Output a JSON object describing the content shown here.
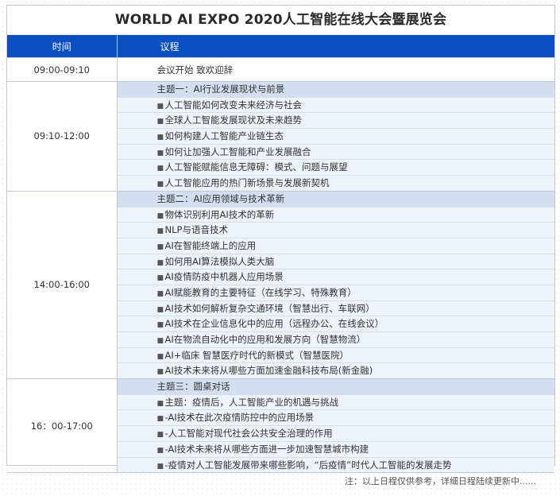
{
  "title": "WORLD AI EXPO 2020人工智能在线大会暨展览会",
  "headers": {
    "time": "时间",
    "agenda": "议程"
  },
  "rows": [
    {
      "time": "09:00-09:10",
      "plain": "会议开始  致欢迎辞"
    },
    {
      "time": "09:10-12:00",
      "theme": "主题一：AI行业发展现状与前景",
      "items": [
        "人工智能如何改变未来经济与社会",
        "全球人工智能发展现状及未来趋势",
        "如何构建人工智能产业链生态",
        "如何让加强人工智能和产业发展融合",
        "人工智能赋能信息无障碍：模式、问题与展望",
        "人工智能应用的热门新场景与发展新契机"
      ]
    },
    {
      "time": "14:00-16:00",
      "theme": "主题二：AI应用领域与技术革新",
      "items": [
        "物体识别利用AI技术的革新",
        "NLP与语音技术",
        "AI在智能终端上的应用",
        "如何用AI算法模拟人类大脑",
        "AI疫情防疫中机器人应用场景",
        "AI赋能教育的主要特征（在线学习、特殊教育）",
        "AI技术如何解析复杂交通环境（智慧出行、车联网）",
        "AI技术在企业信息化中的应用（远程办公、在线会议）",
        "AI在物流自动化中的应用和发展方向（智慧物流）",
        "AI+临床 智慧医疗时代的新模式（智慧医院）",
        "AI技术未来将从哪些方面加速金融科技布局(新金融)"
      ]
    },
    {
      "time": "16：00-17:00",
      "theme": "主题三：圆桌对话",
      "items": [
        "主题：疫情后，人工智能产业的机遇与挑战",
        "-AI技术在此次疫情防控中的应用场景",
        "-人工智能对现代社会公共安全治理的作用",
        "-AI技术未来将从哪些方面进一步加速智慧城市构建",
        "-疫情对人工智能发展带来哪些影响，“后疫情”时代人工智能的发展走势"
      ]
    }
  ],
  "note": "注：以上日程仅供参考，详细日程陆续更新中......",
  "colors": {
    "header_bg": "#0a4fc4",
    "theme_bg": "#d5def0",
    "item_bg": "#eef2f9",
    "border": "#c4c9d3"
  },
  "icons": {
    "bullet": "bullet-icon"
  }
}
